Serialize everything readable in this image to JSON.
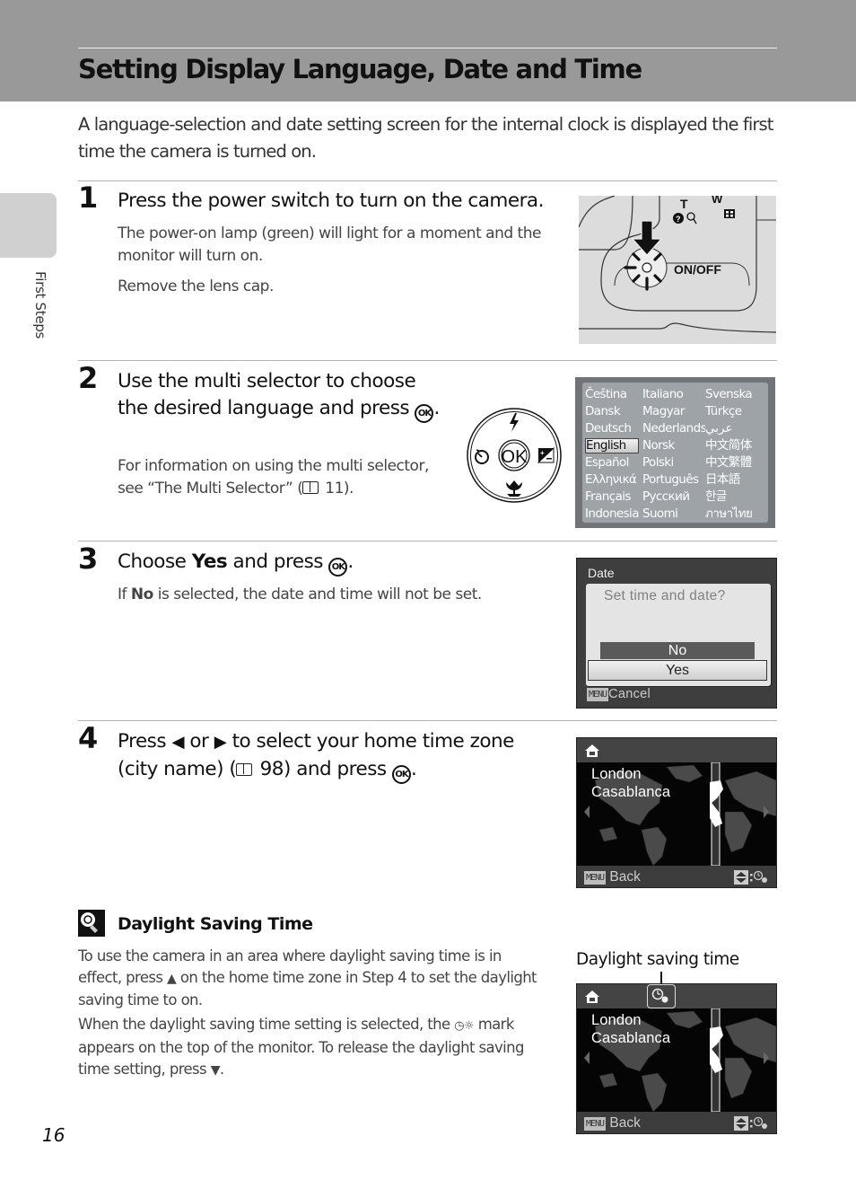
{
  "header": {
    "title": "Setting Display Language, Date and Time"
  },
  "intro": "A language-selection and date setting screen for the internal clock is displayed the first time the camera is turned on.",
  "side_tab": {
    "label": "First Steps"
  },
  "steps": [
    {
      "number": "1",
      "heading": "Press the power switch to turn on the camera.",
      "body": [
        "The power-on lamp (green) will light for a moment and the monitor will turn on.",
        "Remove the lens cap."
      ],
      "illustration": {
        "button_label": "ON/OFF",
        "zoom_tele": "T",
        "zoom_wide": "W"
      }
    },
    {
      "number": "2",
      "heading_pre": "Use the multi selector to choose the desired language and press",
      "heading_post": ".",
      "body_pre": "For information on using the multi selector, see “The Multi Selector” (",
      "body_ref": "11",
      "body_post": ").",
      "multi_selector": {
        "center": "OK"
      },
      "language_screen": {
        "selected": "English",
        "languages": [
          "Čeština",
          "Italiano",
          "Svenska",
          "Dansk",
          "Magyar",
          "Türkçe",
          "Deutsch",
          "Nederlands",
          "عربي",
          "English",
          "Norsk",
          "中文简体",
          "Español",
          "Polski",
          "中文繁體",
          "Ελληνικά",
          "Português",
          "日本語",
          "Français",
          "Русский",
          "한글",
          "Indonesia",
          "Suomi",
          "ภาษาไทย"
        ]
      }
    },
    {
      "number": "3",
      "heading_pre": "Choose ",
      "heading_bold": "Yes",
      "heading_mid": " and press",
      "heading_post": ".",
      "body_pre": "If ",
      "body_bold": "No",
      "body_post": " is selected, the date and time will not be set.",
      "date_screen": {
        "title": "Date",
        "question": "Set time and date?",
        "options": [
          "No",
          "Yes"
        ],
        "selected": "Yes",
        "menu_key": "MENU",
        "cancel": "Cancel"
      }
    },
    {
      "number": "4",
      "heading_pre": "Press",
      "heading_or": "or",
      "heading_mid": "to select your home time zone (city name) (",
      "heading_ref": "98",
      "heading_post": ") and press",
      "heading_end": ".",
      "world_screen": {
        "city_1": "London",
        "city_2": "Casablanca",
        "menu_key": "MENU",
        "back": "Back"
      }
    }
  ],
  "tip": {
    "title": "Daylight Saving Time",
    "para1_pre": "To use the camera in an area where daylight saving time is in effect, press",
    "para1_post": "on the home time zone in Step 4 to set the daylight saving time to on.",
    "para2_pre": "When the daylight saving time setting is selected, the",
    "para2_mid": "mark appears on the top of the monitor. To release the daylight saving time setting, press",
    "para2_post": ".",
    "callout": "Daylight saving time",
    "world_screen": {
      "city_1": "London",
      "city_2": "Casablanca",
      "menu_key": "MENU",
      "back": "Back"
    }
  },
  "page_number": "16"
}
